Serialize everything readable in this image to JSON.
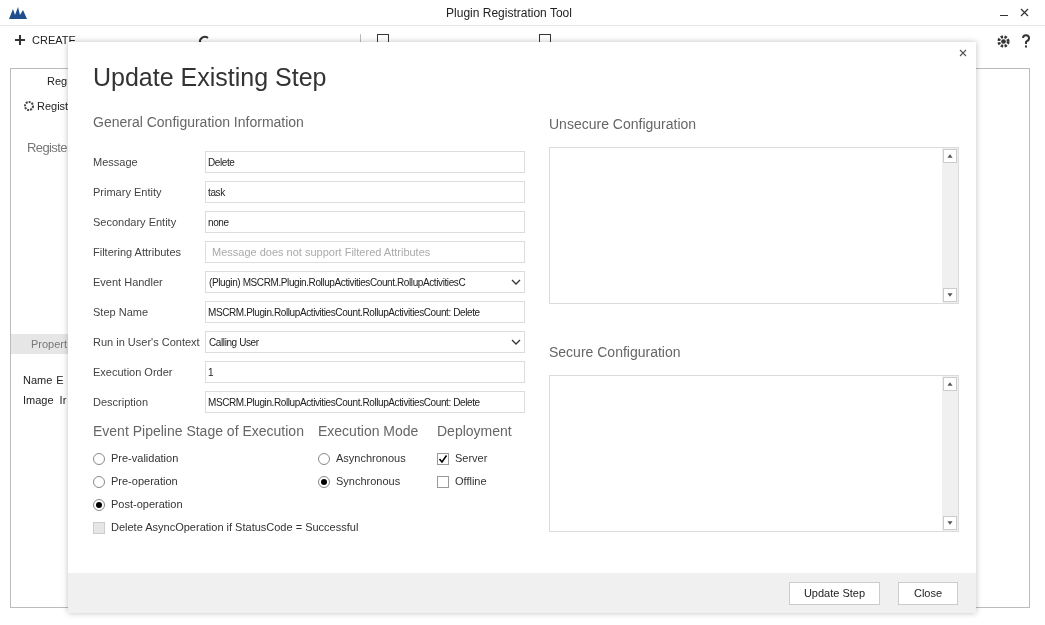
{
  "window": {
    "title": "Plugin Registration Tool"
  },
  "toolbar": {
    "first_label": "CREATE"
  },
  "background": {
    "tab": "Reg",
    "register_button": "Regist",
    "heading": "Registe",
    "properties_header": "Propert",
    "columns": [
      "Name",
      "E"
    ],
    "row": [
      "Image",
      "Ir"
    ]
  },
  "dialog": {
    "title": "Update Existing Step",
    "general_heading": "General Configuration Information",
    "fields": [
      {
        "label": "Message",
        "kind": "text",
        "value": "Delete"
      },
      {
        "label": "Primary Entity",
        "kind": "text",
        "value": "task"
      },
      {
        "label": "Secondary Entity",
        "kind": "text",
        "value": "none"
      },
      {
        "label": "Filtering Attributes",
        "kind": "placeholder",
        "placeholder": "Message does not support Filtered Attributes"
      },
      {
        "label": "Event Handler",
        "kind": "select",
        "value": "(Plugin) MSCRM.Plugin.RollupActivitiesCount.RollupActivitiesC"
      },
      {
        "label": "Step Name",
        "kind": "text",
        "value": "MSCRM.Plugin.RollupActivitiesCount.RollupActivitiesCount: Delete"
      },
      {
        "label": "Run in User's Context",
        "kind": "select",
        "value": "Calling User"
      },
      {
        "label": "Execution Order",
        "kind": "text",
        "value": "1"
      },
      {
        "label": "Description",
        "kind": "text",
        "value": "MSCRM.Plugin.RollupActivitiesCount.RollupActivitiesCount: Delete"
      }
    ],
    "stage": {
      "heading": "Event Pipeline Stage of Execution",
      "options": [
        {
          "label": "Pre-validation",
          "selected": false
        },
        {
          "label": "Pre-operation",
          "selected": false
        },
        {
          "label": "Post-operation",
          "selected": true
        }
      ],
      "async_delete": {
        "label": "Delete AsyncOperation if StatusCode = Successful",
        "checked": false,
        "disabled": true
      }
    },
    "mode": {
      "heading": "Execution Mode",
      "options": [
        {
          "label": "Asynchronous",
          "selected": false
        },
        {
          "label": "Synchronous",
          "selected": true
        }
      ]
    },
    "deployment": {
      "heading": "Deployment",
      "options": [
        {
          "label": "Server",
          "checked": true
        },
        {
          "label": "Offline",
          "checked": false
        }
      ]
    },
    "unsecure_heading": "Unsecure  Configuration",
    "secure_heading": "Secure  Configuration",
    "buttons": [
      "Update Step",
      "Close"
    ]
  }
}
